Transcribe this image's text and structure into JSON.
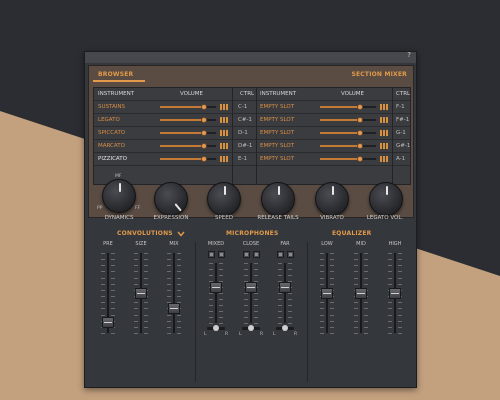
{
  "window": {
    "help_label": "?"
  },
  "browser": {
    "tab_label": "BROWSER",
    "section_label": "SECTION MIXER",
    "left_headers": {
      "instrument": "INSTRUMENT",
      "volume": "VOLUME",
      "ctrl": "CTRL"
    },
    "right_headers": {
      "instrument": "INSTRUMENT",
      "volume": "VOLUME",
      "ctrl": "CTRL"
    },
    "left_rows": [
      {
        "name": "SUSTAINS",
        "ctrl": "C-1",
        "volume": 0.78,
        "selected": false
      },
      {
        "name": "LEGATO",
        "ctrl": "C#-1",
        "volume": 0.78,
        "selected": false
      },
      {
        "name": "SPICCATO",
        "ctrl": "D-1",
        "volume": 0.78,
        "selected": false
      },
      {
        "name": "MARCATO",
        "ctrl": "D#-1",
        "volume": 0.78,
        "selected": false
      },
      {
        "name": "PIZZICATO",
        "ctrl": "E-1",
        "volume": 0.78,
        "selected": true
      }
    ],
    "right_rows": [
      {
        "name": "EMPTY SLOT",
        "ctrl": "F-1",
        "volume": 0.72
      },
      {
        "name": "EMPTY SLOT",
        "ctrl": "F#-1",
        "volume": 0.72
      },
      {
        "name": "EMPTY SLOT",
        "ctrl": "G-1",
        "volume": 0.72
      },
      {
        "name": "EMPTY SLOT",
        "ctrl": "G#-1",
        "volume": 0.72
      },
      {
        "name": "EMPTY SLOT",
        "ctrl": "A-1",
        "volume": 0.72
      }
    ]
  },
  "knobs": {
    "dynamics": {
      "label": "DYNAMICS",
      "mark_top": "MF",
      "mark_left": "PP",
      "mark_right": "FF"
    },
    "expression": {
      "label": "EXPRESSION"
    },
    "speed": {
      "label": "SPEED"
    },
    "release": {
      "label": "RELEASE TAILS"
    },
    "vibrato": {
      "label": "VIBRATO"
    },
    "legato_vol": {
      "label": "LEGATO VOL."
    }
  },
  "convolutions": {
    "title": "CONVOLUTIONS",
    "chevron": "chevron-down-icon",
    "pre": {
      "label": "PRE",
      "level": 0.07
    },
    "size": {
      "label": "SIZE",
      "level": 0.5
    },
    "mix": {
      "label": "MIX",
      "level": 0.28
    }
  },
  "microphones": {
    "title": "MICROPHONES",
    "mixed": {
      "label": "MIXED",
      "level": 0.62,
      "pan_left": "L",
      "pan_right": "R"
    },
    "close": {
      "label": "CLOSE",
      "level": 0.62,
      "pan_left": "L",
      "pan_right": "R"
    },
    "far": {
      "label": "FAR",
      "level": 0.62,
      "pan_left": "L",
      "pan_right": "R"
    }
  },
  "equalizer": {
    "title": "EQUALIZER",
    "low": {
      "label": "LOW",
      "level": 0.5
    },
    "mid": {
      "label": "MID",
      "level": 0.5
    },
    "high": {
      "label": "HIGH",
      "level": 0.5
    }
  },
  "colors": {
    "accent": "#e29a4a",
    "panel": "#34373c",
    "background_dark": "#2b2d32",
    "background_tan": "#c3a07e"
  }
}
